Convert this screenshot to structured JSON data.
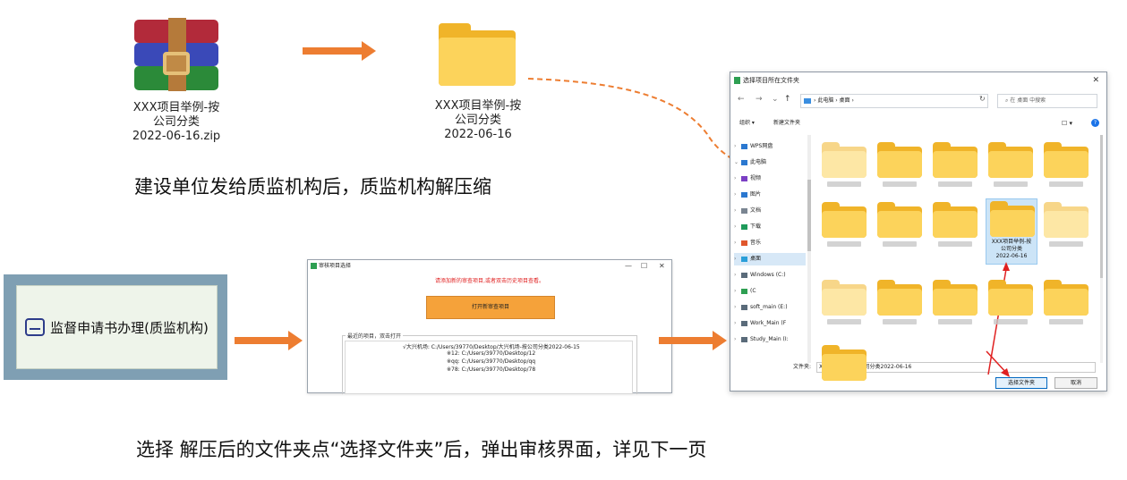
{
  "top_zip": {
    "label_line1": "XXX项目举例-按",
    "label_line2": "公司分类",
    "label_line3": "2022-06-16.zip",
    "icon": "winrar-archive-icon"
  },
  "top_folder": {
    "label_line1": "XXX项目举例-按",
    "label_line2": "公司分类",
    "label_line3": "2022-06-16",
    "icon": "folder-icon"
  },
  "caption_top": "建设单位发给质监机构后，质监机构解压缩",
  "caption_bottom": "选择 解压后的文件夹点“选择文件夹”后，弹出审核界面，详见下一页",
  "supervise_button": {
    "label": "监督申请书办理(质监机构)",
    "icon": "document-car-icon"
  },
  "review_window": {
    "title": "审核项目选择",
    "controls": [
      "—",
      "☐",
      "✕"
    ],
    "warning": "请添加新的审查项目,或者双击历史项目查看。",
    "open_button": "打开新审查项目",
    "recent_group_label": "最近的项目，双击打开",
    "recent_items": [
      "√大兴机场:  C:/Users/39770/Desktop/大兴机场-按公司分类2022-06-15",
      "※12:  C:/Users/39770/Desktop/12",
      "※qq:  C:/Users/39770/Desktop/qq",
      "※78:  C:/Users/39770/Desktop/78"
    ]
  },
  "file_dialog": {
    "title": "选择项目所在文件夹",
    "close": "✕",
    "nav": {
      "back": "←",
      "forward": "→",
      "dropdown": "⌄",
      "up": "↑",
      "refresh": "↻"
    },
    "address": [
      "此电脑",
      "桌面"
    ],
    "search_placeholder": "在 桌面 中搜索",
    "toolbar": {
      "organize": "组织 ▾",
      "new_folder": "新建文件夹",
      "view": "☐ ▾",
      "help": "?"
    },
    "sidebar": [
      {
        "label": "WPS网盘",
        "chev": "›",
        "color": "#2b78d0"
      },
      {
        "label": "此电脑",
        "chev": "⌄",
        "color": "#2b78d0"
      },
      {
        "label": "视频",
        "chev": "›",
        "color": "#7b3fc4"
      },
      {
        "label": "图片",
        "chev": "›",
        "color": "#2b78d0"
      },
      {
        "label": "文档",
        "chev": "›",
        "color": "#7a8591"
      },
      {
        "label": "下载",
        "chev": "›",
        "color": "#1e9a5a"
      },
      {
        "label": "音乐",
        "chev": "›",
        "color": "#e0562c"
      },
      {
        "label": "桌面",
        "chev": "›",
        "color": "#2b9fd9"
      },
      {
        "label": "Windows (C:)",
        "chev": "›",
        "color": "#5a6b7a"
      },
      {
        "label": "(C",
        "chev": "›",
        "color": "#2e9f52"
      },
      {
        "label": "soft_main (E:)",
        "chev": "›",
        "color": "#5a6b7a"
      },
      {
        "label": "Work_Main (F",
        "chev": "›",
        "color": "#5a6b7a"
      },
      {
        "label": "Study_Main (I:",
        "chev": "›",
        "color": "#5a6b7a"
      }
    ],
    "selected_folder": {
      "line1": "XXX项目举例-按",
      "line2": "公司分类",
      "line3": "2022-06-16"
    },
    "filename_label": "文件夹:",
    "filename_value": "XXX项目举例-按公司分类2022-06-16",
    "select_button": "选择文件夹",
    "cancel_button": "取消"
  },
  "colors": {
    "arrow": "#ed7d31",
    "folder_back": "#f0b429",
    "folder_front": "#fcd35b",
    "selection": "#cce4f7",
    "highlight_arrow": "#e02020"
  }
}
